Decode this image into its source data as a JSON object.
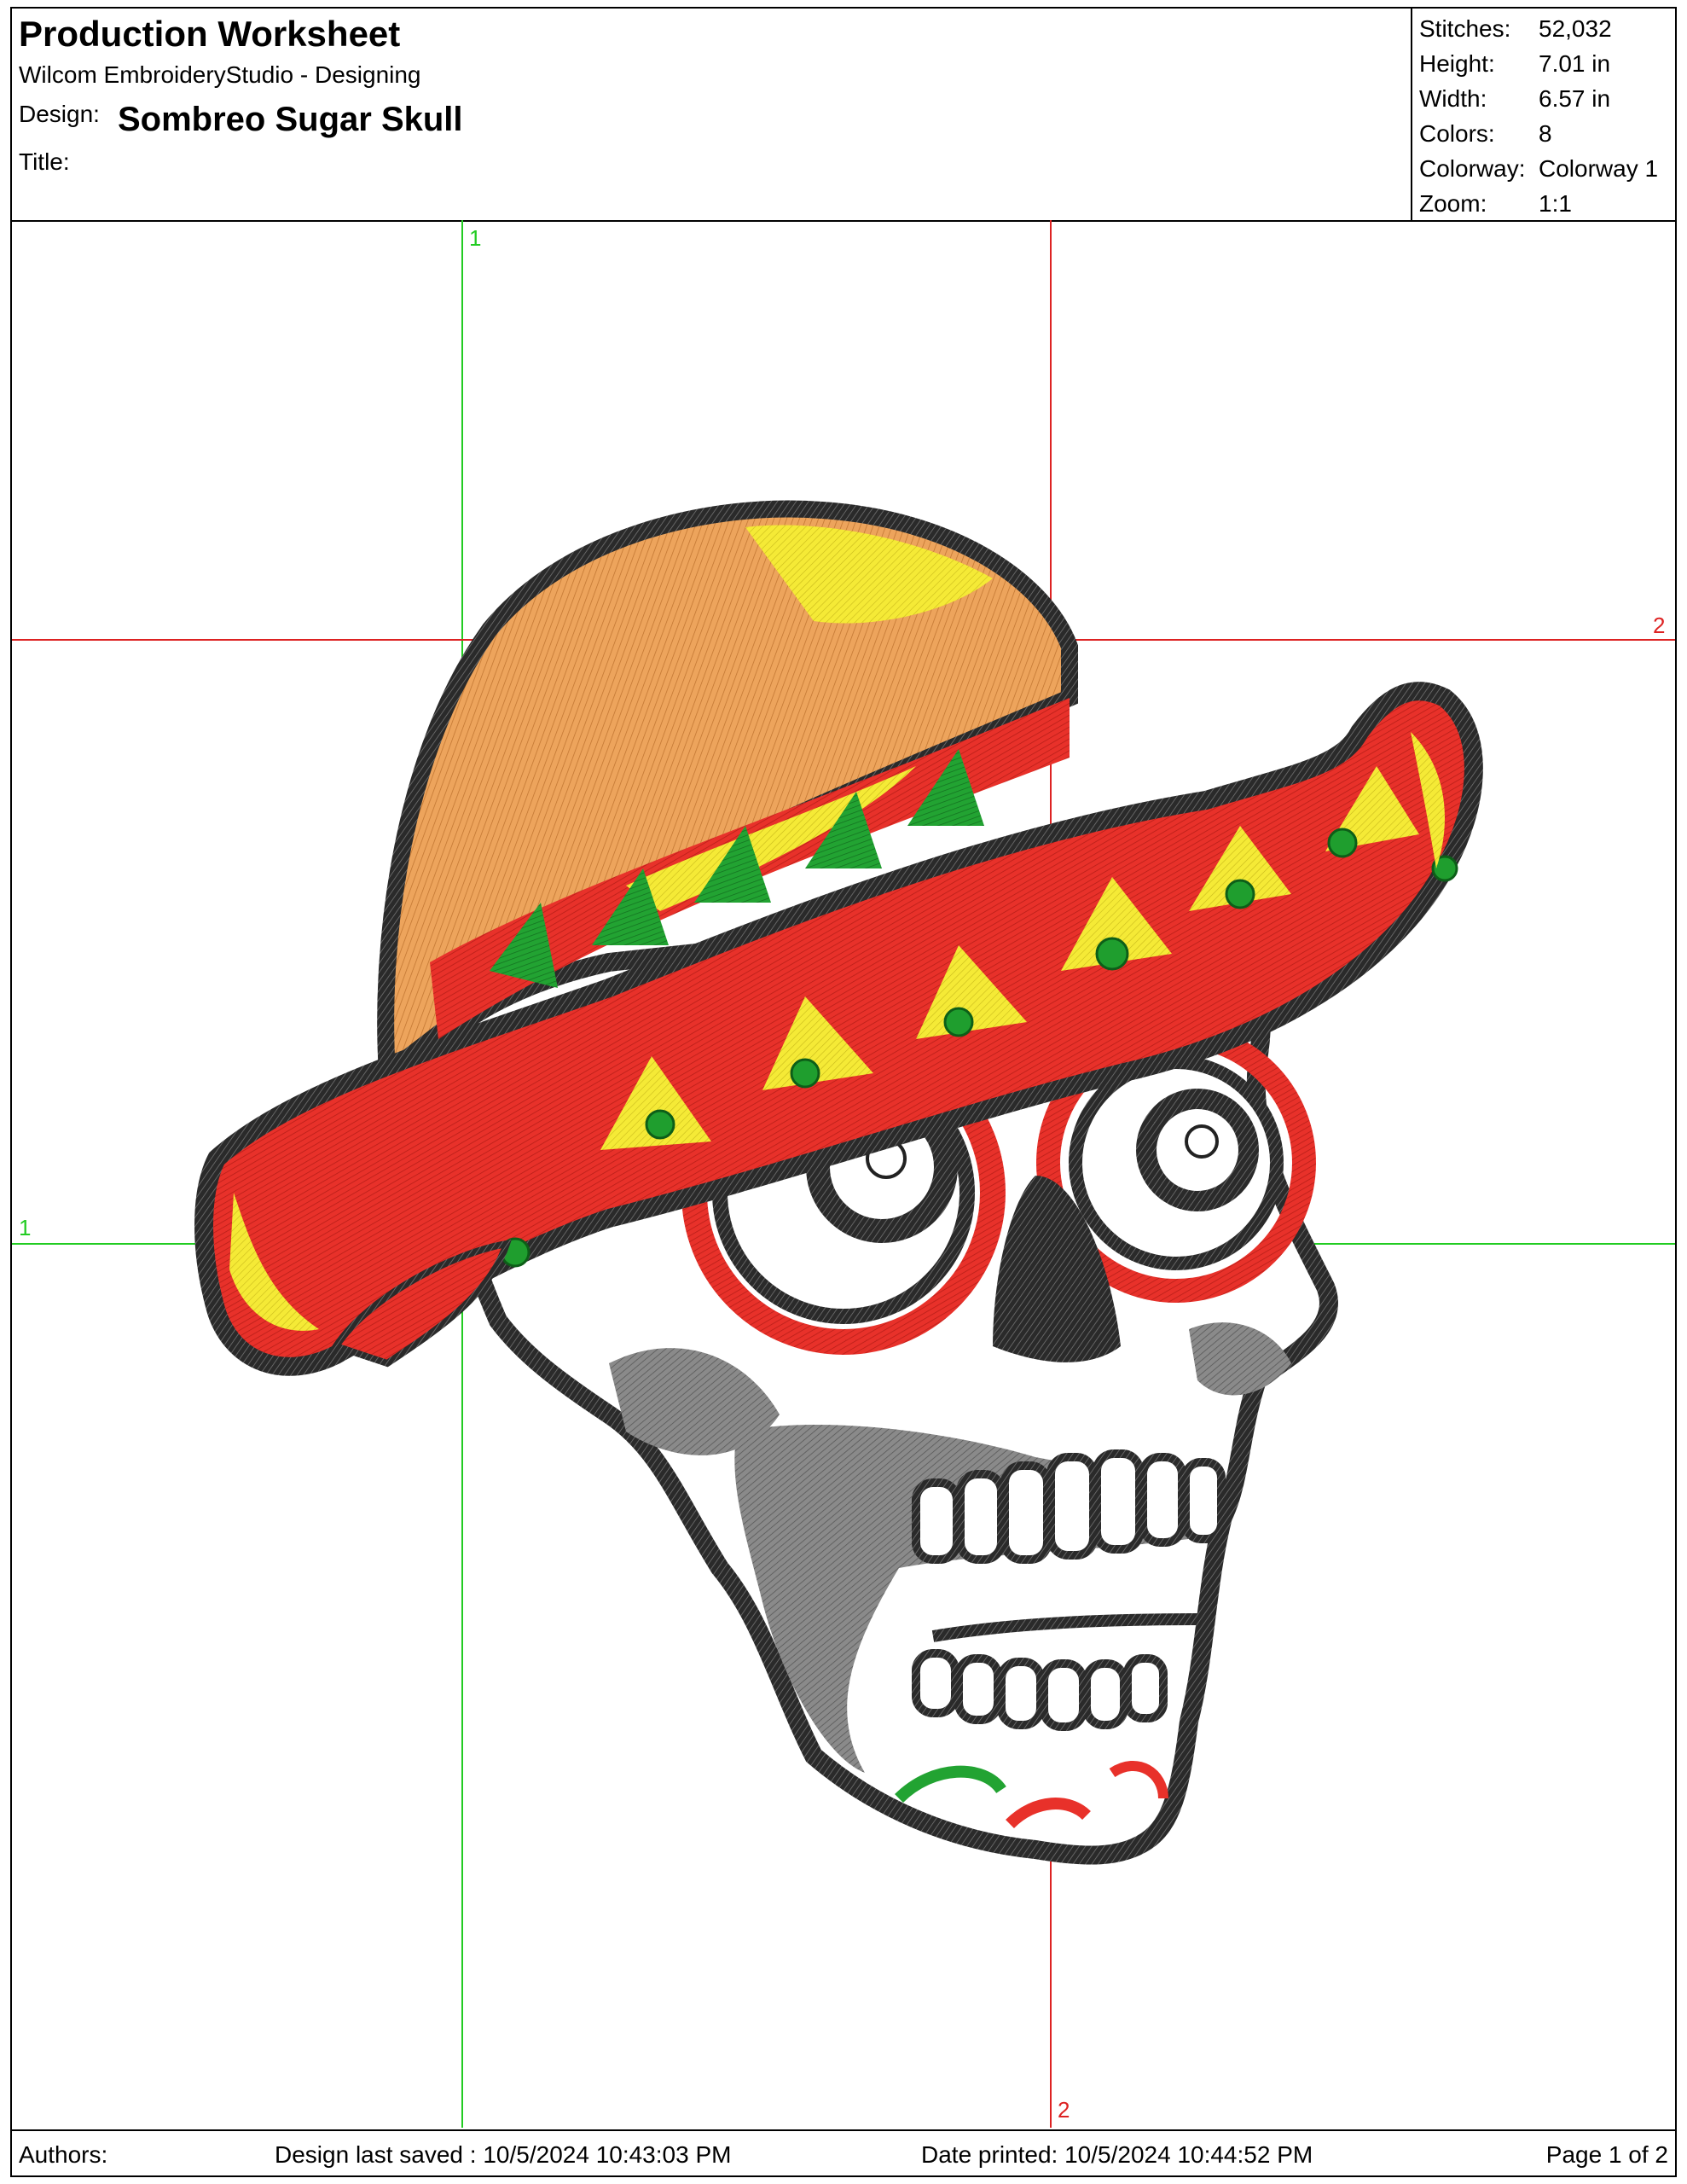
{
  "header": {
    "title": "Production Worksheet",
    "app": "Wilcom EmbroideryStudio - Designing",
    "design_label": "Design:",
    "design_name": "Sombreo Sugar Skull",
    "title_label": "Title:"
  },
  "stats": [
    {
      "label": "Stitches:",
      "value": "52,032"
    },
    {
      "label": "Height:",
      "value": "7.01 in"
    },
    {
      "label": "Width:",
      "value": "6.57 in"
    },
    {
      "label": "Colors:",
      "value": "8"
    },
    {
      "label": "Colorway:",
      "value": "Colorway 1"
    },
    {
      "label": "Zoom:",
      "value": "1:1"
    }
  ],
  "guides": {
    "vertical_1": "1",
    "horizontal_2": "2",
    "horizontal_1": "1",
    "vertical_2": "2",
    "color_green": "#22cc22",
    "color_red": "#dd2222"
  },
  "footer": {
    "authors": "Authors:",
    "saved": "Design last saved : 10/5/2024 10:43:03 PM",
    "printed": "Date printed: 10/5/2024 10:44:52 PM",
    "page": "Page 1 of 2"
  },
  "artwork": {
    "icon": "sombrero-sugar-skull-embroidery",
    "colors": [
      "#e8312a",
      "#1f9e2e",
      "#f2e12a",
      "#e9a25a",
      "#1a1a1a",
      "#888888",
      "#ffffff",
      "#c96a2a"
    ]
  }
}
